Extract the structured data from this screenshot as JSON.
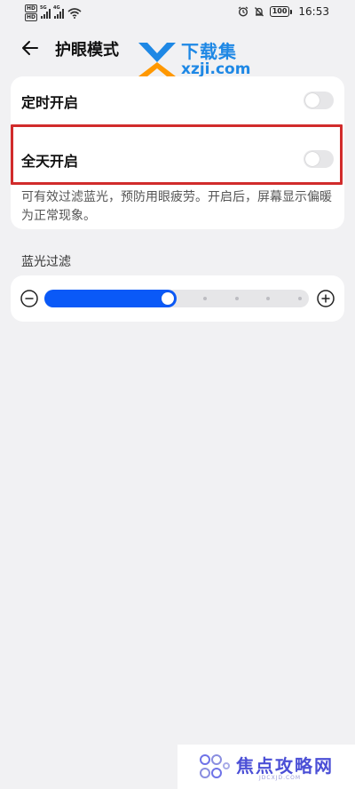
{
  "status_bar": {
    "hd_badges": [
      "HD",
      "HD"
    ],
    "network_labels": [
      "5G",
      "4G"
    ],
    "battery": "100",
    "time": "16:53"
  },
  "header": {
    "back_icon": "arrow-left-icon",
    "title": "护眼模式"
  },
  "watermark_top": {
    "brand": "下载集",
    "domain": "xzji.com"
  },
  "settings": {
    "rows": [
      {
        "label": "定时开启",
        "enabled": false
      },
      {
        "label": "全天开启",
        "enabled": false
      }
    ],
    "description": "可有效过滤蓝光，预防用眼疲劳。开启后，屏幕显示偏暖为正常现象。"
  },
  "filter": {
    "section_title": "蓝光过滤",
    "level_fraction": 0.5,
    "tick_count": 4,
    "minus_icon": "minus-circle-icon",
    "plus_icon": "plus-circle-icon",
    "fill_color": "#0a59f7"
  },
  "highlight_color": "#d12b2b",
  "watermark_bottom": {
    "text": "焦点攻略网",
    "sub": "JDCXJD.COM"
  }
}
